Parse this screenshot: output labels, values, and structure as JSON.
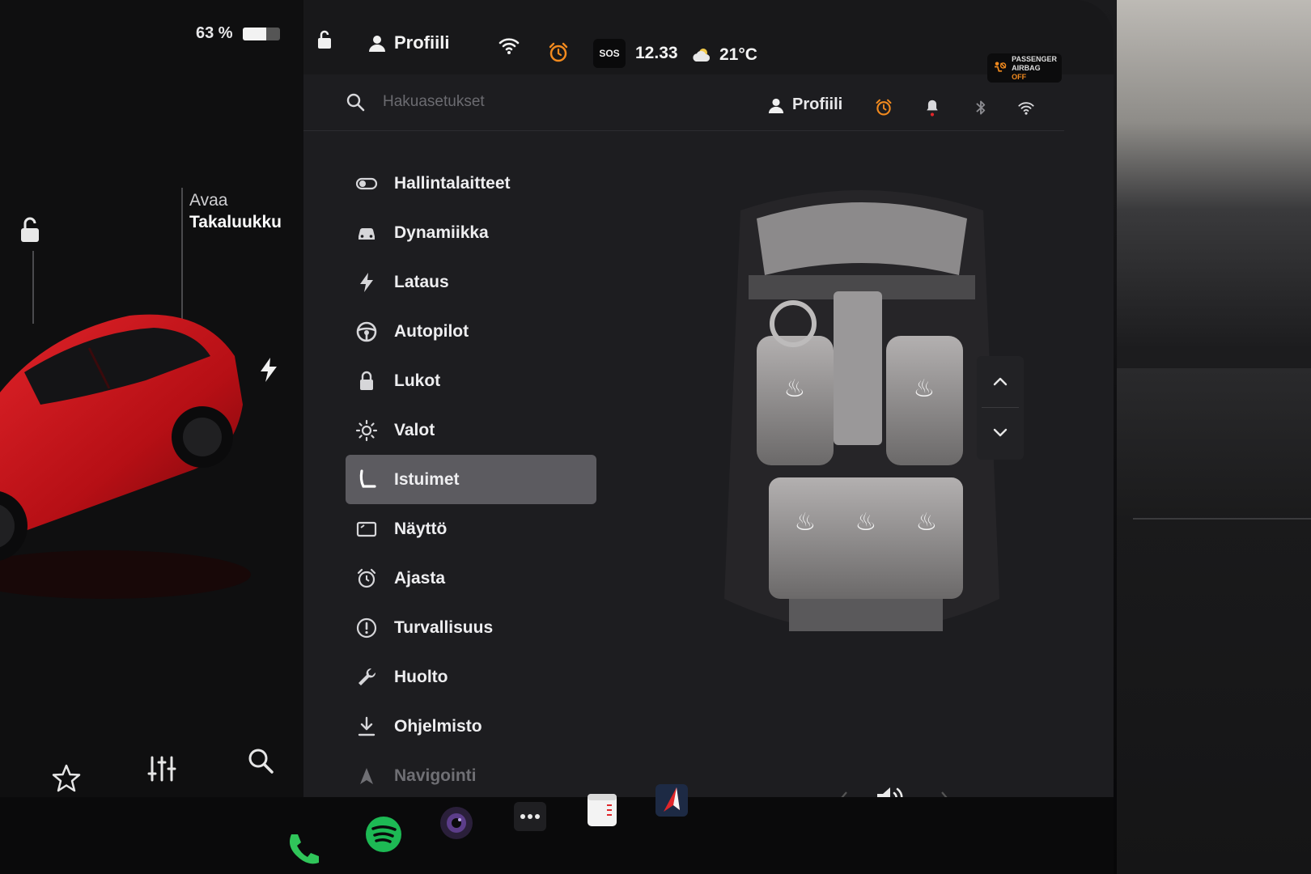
{
  "status": {
    "battery_percent_label": "63 %",
    "battery_level": 0.63,
    "profile": "Profiili",
    "sos": "SOS",
    "time": "12.33",
    "temperature": "21°C",
    "airbag_line1": "PASSENGER",
    "airbag_line2": "AIRBAG",
    "airbag_state": "OFF"
  },
  "car_panel": {
    "trunk_action": "Avaa",
    "trunk_label": "Takaluukku"
  },
  "settings": {
    "search_placeholder": "Hakuasetukset",
    "profile": "Profiili",
    "menu": [
      {
        "label": "Hallintalaitteet",
        "icon": "toggle-icon"
      },
      {
        "label": "Dynamiikka",
        "icon": "car-icon"
      },
      {
        "label": "Lataus",
        "icon": "bolt-icon"
      },
      {
        "label": "Autopilot",
        "icon": "steering-wheel-icon"
      },
      {
        "label": "Lukot",
        "icon": "lock-icon"
      },
      {
        "label": "Valot",
        "icon": "sun-icon"
      },
      {
        "label": "Istuimet",
        "icon": "seat-icon",
        "active": true
      },
      {
        "label": "Näyttö",
        "icon": "display-icon"
      },
      {
        "label": "Ajasta",
        "icon": "alarm-icon"
      },
      {
        "label": "Turvallisuus",
        "icon": "alert-circle-icon"
      },
      {
        "label": "Huolto",
        "icon": "wrench-icon"
      },
      {
        "label": "Ohjelmisto",
        "icon": "download-icon"
      },
      {
        "label": "Navigointi",
        "icon": "navigation-icon"
      }
    ]
  },
  "colors": {
    "accent_orange": "#f28a1e",
    "car_red": "#c8141b",
    "active_item": "#5c5b60",
    "notification_red": "#e0262a",
    "spotify_green": "#1db954",
    "phone_green": "#30c55a"
  }
}
